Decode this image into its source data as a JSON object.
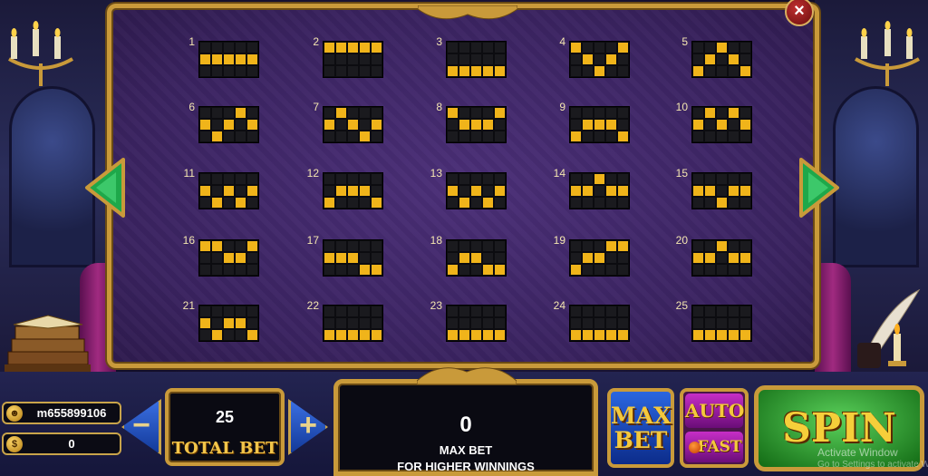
{
  "paytable": {
    "close_label": "×",
    "lines": [
      {
        "num": "1",
        "pattern": [
          "00000",
          "11111",
          "00000"
        ]
      },
      {
        "num": "2",
        "pattern": [
          "11111",
          "00000",
          "00000"
        ]
      },
      {
        "num": "3",
        "pattern": [
          "00000",
          "00000",
          "11111"
        ]
      },
      {
        "num": "4",
        "pattern": [
          "10001",
          "01010",
          "00100"
        ]
      },
      {
        "num": "5",
        "pattern": [
          "00100",
          "01010",
          "10001"
        ]
      },
      {
        "num": "6",
        "pattern": [
          "00010",
          "10101",
          "01000"
        ]
      },
      {
        "num": "7",
        "pattern": [
          "01000",
          "10101",
          "00010"
        ]
      },
      {
        "num": "8",
        "pattern": [
          "10001",
          "01110",
          "00000"
        ]
      },
      {
        "num": "9",
        "pattern": [
          "00000",
          "01110",
          "10001"
        ]
      },
      {
        "num": "10",
        "pattern": [
          "01010",
          "10101",
          "00000"
        ]
      },
      {
        "num": "11",
        "pattern": [
          "00000",
          "10101",
          "01010"
        ]
      },
      {
        "num": "12",
        "pattern": [
          "00000",
          "01110",
          "10001"
        ]
      },
      {
        "num": "13",
        "pattern": [
          "00000",
          "10101",
          "01010"
        ]
      },
      {
        "num": "14",
        "pattern": [
          "00100",
          "11011",
          "00000"
        ]
      },
      {
        "num": "15",
        "pattern": [
          "00000",
          "11011",
          "00100"
        ]
      },
      {
        "num": "16",
        "pattern": [
          "11001",
          "00110",
          "00000"
        ]
      },
      {
        "num": "17",
        "pattern": [
          "00000",
          "11100",
          "00011"
        ]
      },
      {
        "num": "18",
        "pattern": [
          "00000",
          "01100",
          "10011"
        ]
      },
      {
        "num": "19",
        "pattern": [
          "00011",
          "01100",
          "10000"
        ]
      },
      {
        "num": "20",
        "pattern": [
          "00100",
          "11011",
          "00000"
        ]
      },
      {
        "num": "21",
        "pattern": [
          "00000",
          "10110",
          "01001"
        ]
      },
      {
        "num": "22",
        "pattern": [
          "00000",
          "00000",
          "11111"
        ]
      },
      {
        "num": "23",
        "pattern": [
          "00000",
          "00000",
          "11111"
        ]
      },
      {
        "num": "24",
        "pattern": [
          "00000",
          "00000",
          "11111"
        ]
      },
      {
        "num": "25",
        "pattern": [
          "00000",
          "00000",
          "11111"
        ]
      }
    ]
  },
  "account": {
    "username": "m655899106",
    "balance": "0"
  },
  "bet": {
    "minus_label": "−",
    "plus_label": "+",
    "total_value": "25",
    "total_label": "TOTAL BET"
  },
  "win": {
    "value": "0",
    "message_line1": "MAX BET",
    "message_line2": "FOR HIGHER WINNINGS"
  },
  "controls": {
    "max_bet_line1": "MAX",
    "max_bet_line2": "BET",
    "auto_label": "AUTO",
    "fast_label": "FAST",
    "spin_label": "SPIN"
  },
  "watermark": {
    "line1": "Activate Window",
    "line2": "Go to Settings to activate Windows."
  },
  "colors": {
    "payline_on": "#f0b41a",
    "payline_off": "#1a1a1e",
    "frame_gold": "#c99a3a",
    "panel_purple": "#3a2360"
  }
}
